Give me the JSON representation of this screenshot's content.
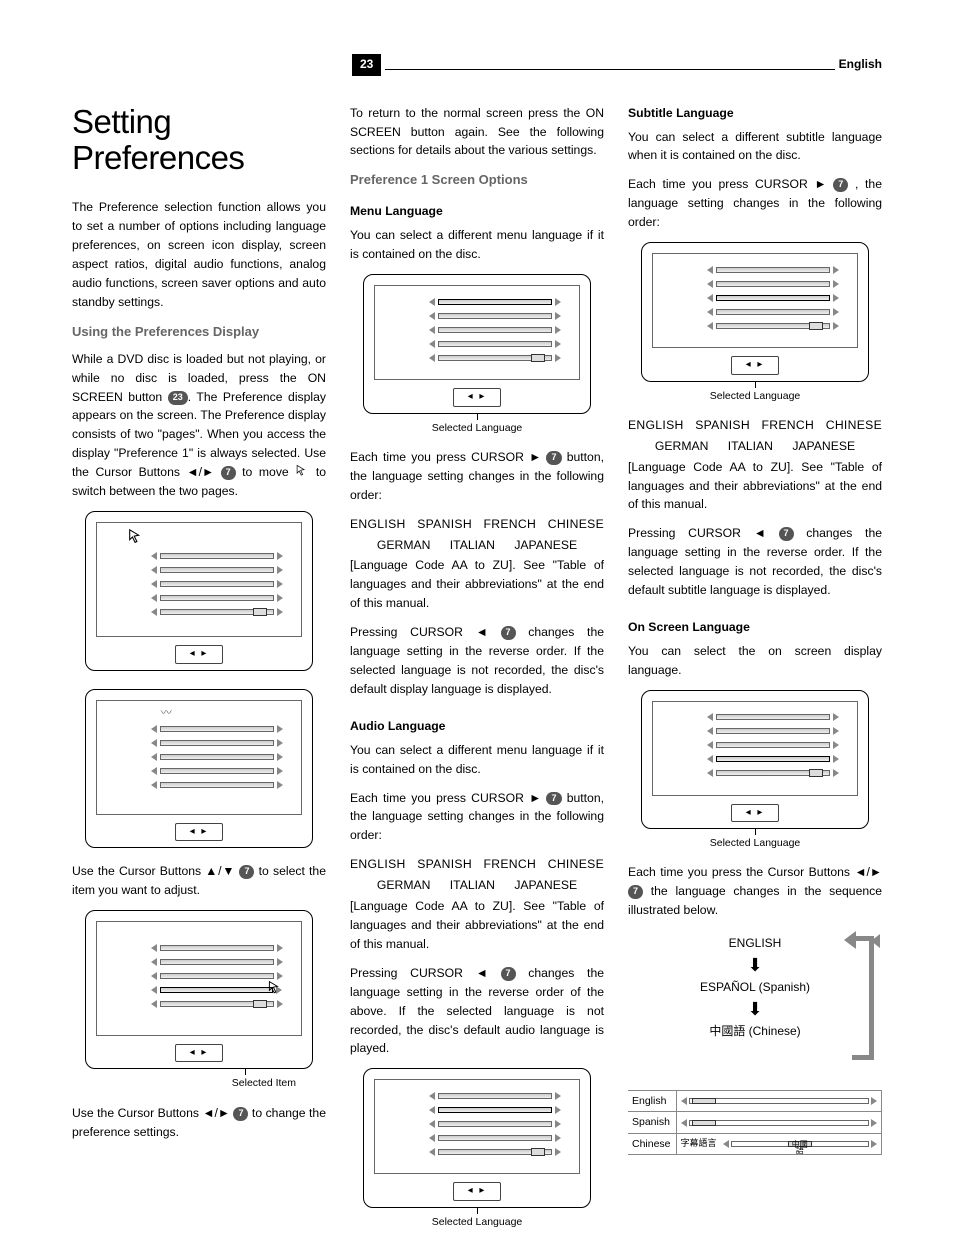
{
  "header": {
    "page": "23",
    "lang": "English"
  },
  "col1": {
    "title": "Setting Preferences",
    "intro": "The Preference selection function allows you to set a number of options including language preferences, on screen icon display, screen aspect ratios, digital audio functions, analog audio functions, screen saver options and auto standby settings.",
    "h2": "Using the Preferences Display",
    "p1a": "While a DVD disc is loaded but not playing, or while no disc is loaded, press the ON SCREEN button ",
    "btn23": "23",
    "p1b": ". The Preference display appears on the screen. The Preference display consists of two \"pages\". When you access the display \"Preference 1\" is always selected. Use the Cursor Buttons ◄/► ",
    "btn7": "7",
    "p1c": " to move ",
    "p1d": " to switch between the two pages.",
    "p2a": "Use the Cursor Buttons ▲/▼ ",
    "p2b": " to select the item  you want to adjust.",
    "cap_selected_item": "Selected Item",
    "p3a": "Use the Cursor Buttons ◄/► ",
    "p3b": " to change the preference settings."
  },
  "col2": {
    "p0": "To return to the normal screen press the ON SCREEN button again. See the following sections for details about the various settings.",
    "h2": "Preference 1 Screen Options",
    "h3a": "Menu Language",
    "p_menu": "You can select a different menu language if it is contained on the disc.",
    "cap_sel_lang": "Selected Language",
    "p_each_a": "Each time you press CURSOR ► ",
    "p_each_b": " button, the language setting changes in the following order:",
    "langs1": "ENGLISH SPANISH FRENCH CHINESE",
    "langs2": "GERMAN ITALIAN JAPANESE",
    "p_code": "[Language Code AA to ZU]. See \"Table of languages and their abbreviations\" at the end of this manual.",
    "p_rev_a": "Pressing CURSOR ◄ ",
    "p_rev_menu": " changes the language setting in the reverse order. If the selected language is not recorded, the disc's default display language is displayed.",
    "h3b": "Audio Language",
    "p_audio1": "You can select a different menu language if it is contained on the disc.",
    "p_rev_audio": " changes the language setting in the reverse order of the above. If the selected language is not recorded, the disc's default audio language is played."
  },
  "col3": {
    "h3a": "Subtitle Language",
    "p_sub": "You can select a different subtitle language when it is contained on the disc.",
    "p_each3a": "Each time you press CURSOR ► ",
    "p_each3b": " , the language setting changes in the following order:",
    "p_rev_sub": " changes the language setting in the reverse order. If the selected language is not recorded, the disc's default subtitle language is displayed.",
    "h3b": "On Screen Language",
    "p_osl": "You can select the on screen display language.",
    "p_seq_a": "Each time you press the Cursor Buttons ◄/► ",
    "p_seq_b": " the language changes in the sequence illustrated below.",
    "seq": {
      "e": "ENGLISH",
      "s": "ESPAÑOL (Spanish)",
      "c": "中國語 (Chinese)"
    },
    "table": {
      "r1": "English",
      "r2": "Spanish",
      "r3": "Chinese",
      "r3b": "字幕語言",
      "r3c": "中國語"
    }
  }
}
